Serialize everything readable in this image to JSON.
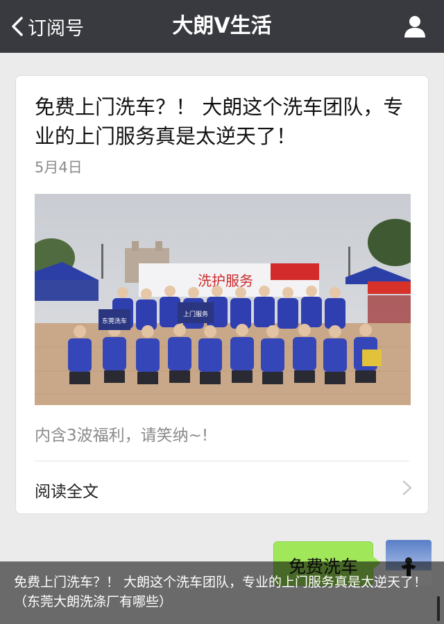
{
  "navbar": {
    "back_label": "订阅号",
    "title": "大朗V生活",
    "back_icon": "chevron-left-icon",
    "profile_icon": "person-icon"
  },
  "article": {
    "title": "免费上门洗车？！ 大朗这个洗车团队，专业的上门服务真是太逆天了！",
    "date": "5月4日",
    "image_alt": "photo",
    "banner_text": "洗护服务",
    "sign_left": "东莞洗车",
    "sign_right": "上门服务",
    "description": "内含3波福利，请笑纳~!",
    "read_more_label": "阅读全文"
  },
  "chat": {
    "bubble_text": "免费洗车"
  },
  "caption": {
    "text": "免费上门洗车？！ 大朗这个洗车团队，专业的上门服务真是太逆天了！（东莞大朗洗涤厂有哪些）"
  },
  "colors": {
    "navbar_bg": "#393a3f",
    "bubble_green": "#a0e75a",
    "background": "#ebebeb"
  }
}
